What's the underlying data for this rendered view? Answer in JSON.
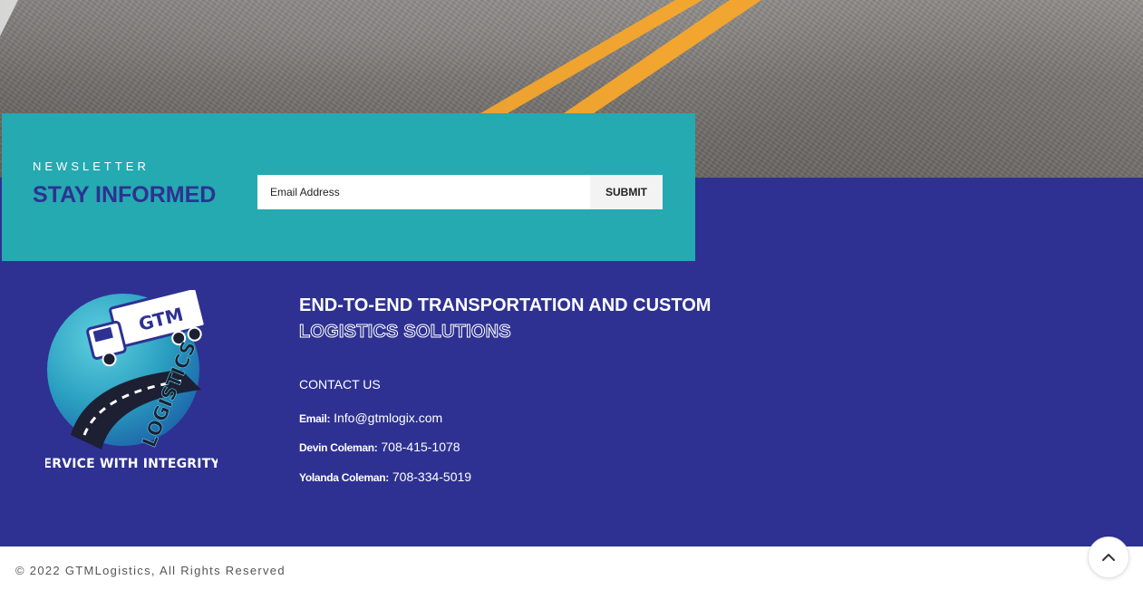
{
  "newsletter": {
    "kicker": "NEWSLETTER",
    "title": "STAY INFORMED",
    "email_placeholder": "Email Address",
    "submit_label": "SUBMIT"
  },
  "logo": {
    "wordmark_top": "GTM",
    "wordmark_side": "LOGISTICS",
    "slogan": "SERVICE WITH INTEGRITY"
  },
  "footer": {
    "tagline_line1": "END-TO-END TRANSPORTATION AND CUSTOM",
    "tagline_line2": "LOGISTICS SOLUTIONS",
    "contact_heading": "CONTACT US",
    "contacts": [
      {
        "label": "Email:",
        "value": "Info@gtmlogix.com"
      },
      {
        "label": "Devin Coleman:",
        "value": "708-415-1078"
      },
      {
        "label": "Yolanda Coleman:",
        "value": "708-334-5019"
      }
    ],
    "copyright": "© 2022 GTMLogistics, All Rights Reserved"
  },
  "icons": {
    "scroll_top": "chevron-up-icon"
  },
  "colors": {
    "brand_blue": "#2e3192",
    "teal": "#24aab0",
    "road_line": "#f2a630"
  }
}
